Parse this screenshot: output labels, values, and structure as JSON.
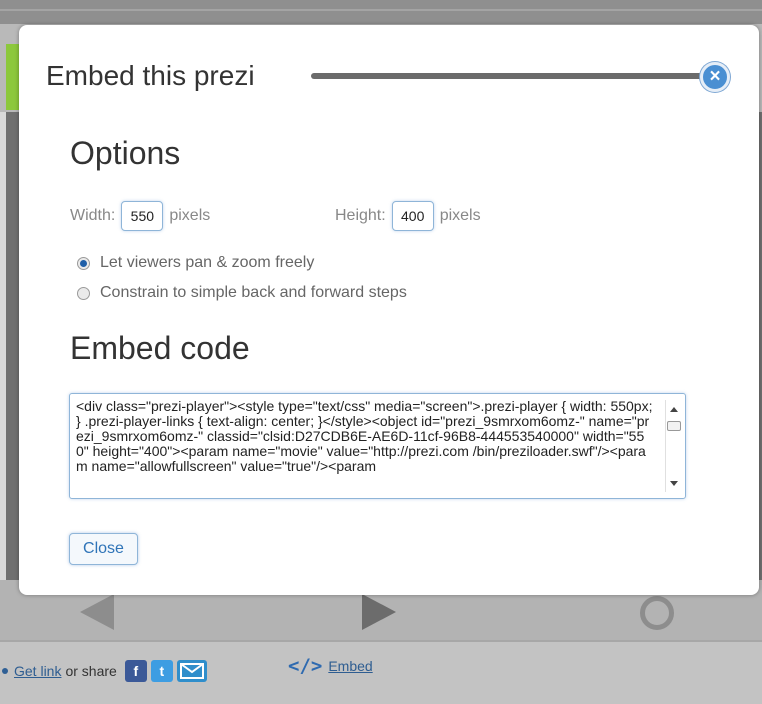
{
  "modal": {
    "title": "Embed this prezi",
    "close_icon_glyph": "×",
    "options_heading": "Options",
    "width_label": "Width:",
    "width_value": "550",
    "width_unit": "pixels",
    "height_label": "Height:",
    "height_value": "400",
    "height_unit": "pixels",
    "radio_options": [
      {
        "label": "Let viewers pan & zoom freely",
        "checked": true
      },
      {
        "label": "Constrain to simple back and forward steps",
        "checked": false
      }
    ],
    "embed_heading": "Embed code",
    "embed_code": "<div class=\"prezi-player\"><style type=\"text/css\" media=\"screen\">.prezi-player { width: 550px; } .prezi-player-links { text-align: center; }</style><object id=\"prezi_9smrxom6omz-\" name=\"prezi_9smrxom6omz-\" classid=\"clsid:D27CDB6E-AE6D-11cf-96B8-444553540000\" width=\"550\" height=\"400\"><param name=\"movie\" value=\"http://prezi.com /bin/preziloader.swf\"/><param name=\"allowfullscreen\" value=\"true\"/><param",
    "close_button_label": "Close"
  },
  "footer": {
    "get_link_label": "Get link",
    "or_share_text": "or share",
    "facebook_glyph": "f",
    "twitter_glyph": "t",
    "embed_glyph": "</>",
    "embed_label": "Embed"
  },
  "colors": {
    "accent_blue": "#2f74b8",
    "brand_green": "#8cc83c",
    "overlay_grey": "#707070"
  }
}
